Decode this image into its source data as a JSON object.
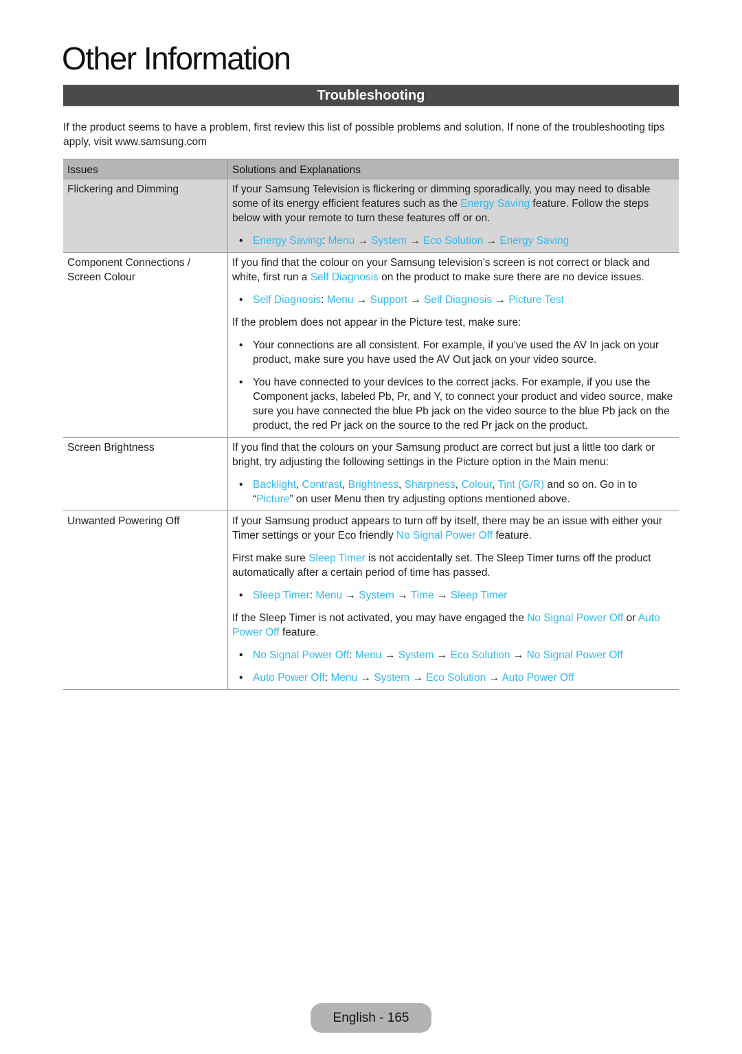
{
  "page_title": "Other Information",
  "section_title": "Troubleshooting",
  "intro": "If the product seems to have a problem, first review this list of possible problems and solution. If none of the troubleshooting tips apply, visit www.samsung.com",
  "colors": {
    "link": "#33b9ee",
    "section_bar": "#4a4a4a",
    "header_row": "#b5b5b5",
    "shaded_row": "#d6d6d6"
  },
  "table": {
    "headers": {
      "issues": "Issues",
      "solutions": "Solutions and Explanations"
    },
    "rows": [
      {
        "issue": "Flickering and Dimming",
        "p1": {
          "a": "If your Samsung Television is flickering or dimming sporadically, you may need to disable some of its energy efficient features such as the ",
          "link": "Energy Saving",
          "b": " feature. Follow the steps below with your remote to turn these features off or on."
        },
        "path": {
          "name": "Energy Saving",
          "steps": [
            "Menu",
            "System",
            "Eco Solution",
            "Energy Saving"
          ]
        }
      },
      {
        "issue": "Component Connections / Screen Colour",
        "p1": {
          "a": "If you find that the colour on your Samsung television’s screen is not correct or black and white, first run a ",
          "link": "Self Diagnosis",
          "b": " on the product to make sure there are no device issues."
        },
        "path": {
          "name": "Self Diagnosis",
          "steps": [
            "Menu",
            "Support",
            "Self Diagnosis",
            "Picture Test"
          ]
        },
        "p2": "If the problem does not appear in the Picture test, make sure:",
        "bullets": [
          "Your connections are all consistent. For example, if you’ve used the AV In jack on your product, make sure you have used the AV Out jack on your video source.",
          "You have connected to your devices to the correct jacks. For example, if you use the Component jacks, labeled Pb, Pr, and Y, to connect your product and video source, make sure you have connected the blue Pb jack on the video source to the blue Pb jack on the product, the red Pr jack on the source to the red Pr jack on the product."
        ]
      },
      {
        "issue": "Screen Brightness",
        "p1": "If you find that the colours on your Samsung product are correct but just a little too dark or bright, try adjusting the following settings in the Picture option in the Main menu:",
        "settings": [
          "Backlight",
          "Contrast",
          "Brightness",
          "Sharpness",
          "Colour",
          "Tint (G/R)"
        ],
        "settings_tail_a": " and so on. Go in to “",
        "settings_link": "Picture",
        "settings_tail_b": "” on user Menu then try adjusting options mentioned above."
      },
      {
        "issue": "Unwanted Powering Off",
        "p1": {
          "a": "If your Samsung product appears to turn off by itself, there may be an issue with either your Timer settings or your Eco friendly ",
          "link": "No Signal Power Off",
          "b": " feature."
        },
        "p2": {
          "a": "First make sure ",
          "link": "Sleep Timer",
          "b": " is not accidentally set. The Sleep Timer turns off the product automatically after a certain period of time has passed."
        },
        "path1": {
          "name": "Sleep Timer",
          "steps": [
            "Menu",
            "System",
            "Time",
            "Sleep Timer"
          ]
        },
        "p3": {
          "a": "If the Sleep Timer is not activated, you may have engaged the ",
          "link1": "No Signal Power Off",
          "mid": " or ",
          "link2": "Auto Power Off",
          "b": " feature."
        },
        "path2": {
          "name": "No Signal Power Off",
          "steps": [
            "Menu",
            "System",
            "Eco Solution",
            "No Signal Power Off"
          ]
        },
        "path3": {
          "name": "Auto Power Off",
          "steps": [
            "Menu",
            "System",
            "Eco Solution",
            "Auto Power Off"
          ]
        }
      }
    ]
  },
  "symbols": {
    "colon": ": ",
    "arrow": " → ",
    "comma": ", "
  },
  "footer": {
    "label": "English - 165"
  }
}
